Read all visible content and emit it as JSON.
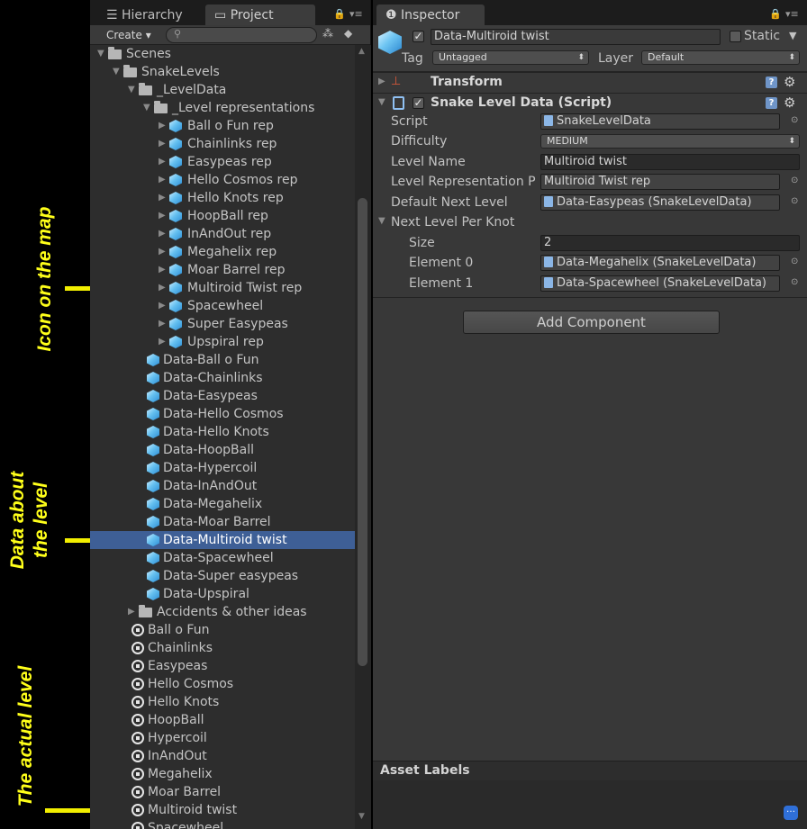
{
  "annotations": [
    {
      "text": "Icon on the map"
    },
    {
      "text": "Data about\nthe level"
    },
    {
      "text": "The actual level"
    }
  ],
  "project": {
    "tabs": [
      {
        "label": "Hierarchy"
      },
      {
        "label": "Project"
      }
    ],
    "create_label": "Create",
    "search_placeholder": "",
    "tree": [
      {
        "kind": "folder",
        "depth": 0,
        "open": true,
        "label": "Scenes"
      },
      {
        "kind": "folder",
        "depth": 1,
        "open": true,
        "label": "SnakeLevels"
      },
      {
        "kind": "folder",
        "depth": 2,
        "open": true,
        "label": "_LevelData"
      },
      {
        "kind": "folder",
        "depth": 3,
        "open": true,
        "label": "_Level representations"
      },
      {
        "kind": "prefab",
        "depth": 4,
        "label": "Ball o Fun rep"
      },
      {
        "kind": "prefab",
        "depth": 4,
        "label": "Chainlinks rep"
      },
      {
        "kind": "prefab",
        "depth": 4,
        "label": "Easypeas rep"
      },
      {
        "kind": "prefab",
        "depth": 4,
        "label": "Hello Cosmos rep"
      },
      {
        "kind": "prefab",
        "depth": 4,
        "label": "Hello Knots rep"
      },
      {
        "kind": "prefab",
        "depth": 4,
        "label": "HoopBall rep"
      },
      {
        "kind": "prefab",
        "depth": 4,
        "label": "InAndOut rep"
      },
      {
        "kind": "prefab",
        "depth": 4,
        "label": "Megahelix rep"
      },
      {
        "kind": "prefab",
        "depth": 4,
        "label": "Moar Barrel rep"
      },
      {
        "kind": "prefab",
        "depth": 4,
        "label": "Multiroid Twist rep"
      },
      {
        "kind": "prefab",
        "depth": 4,
        "label": "Spacewheel"
      },
      {
        "kind": "prefab",
        "depth": 4,
        "label": "Super Easypeas"
      },
      {
        "kind": "prefab",
        "depth": 4,
        "label": "Upspiral rep"
      },
      {
        "kind": "asset",
        "depth": 3,
        "label": "Data-Ball o Fun"
      },
      {
        "kind": "asset",
        "depth": 3,
        "label": "Data-Chainlinks"
      },
      {
        "kind": "asset",
        "depth": 3,
        "label": "Data-Easypeas"
      },
      {
        "kind": "asset",
        "depth": 3,
        "label": "Data-Hello Cosmos"
      },
      {
        "kind": "asset",
        "depth": 3,
        "label": "Data-Hello Knots"
      },
      {
        "kind": "asset",
        "depth": 3,
        "label": "Data-HoopBall"
      },
      {
        "kind": "asset",
        "depth": 3,
        "label": "Data-Hypercoil"
      },
      {
        "kind": "asset",
        "depth": 3,
        "label": "Data-InAndOut"
      },
      {
        "kind": "asset",
        "depth": 3,
        "label": "Data-Megahelix"
      },
      {
        "kind": "asset",
        "depth": 3,
        "label": "Data-Moar Barrel"
      },
      {
        "kind": "asset",
        "depth": 3,
        "label": "Data-Multiroid twist",
        "selected": true
      },
      {
        "kind": "asset",
        "depth": 3,
        "label": "Data-Spacewheel"
      },
      {
        "kind": "asset",
        "depth": 3,
        "label": "Data-Super easypeas"
      },
      {
        "kind": "asset",
        "depth": 3,
        "label": "Data-Upspiral"
      },
      {
        "kind": "folder",
        "depth": 2,
        "open": false,
        "label": "Accidents & other ideas"
      },
      {
        "kind": "scene",
        "depth": 2,
        "label": "Ball o Fun"
      },
      {
        "kind": "scene",
        "depth": 2,
        "label": "Chainlinks"
      },
      {
        "kind": "scene",
        "depth": 2,
        "label": "Easypeas"
      },
      {
        "kind": "scene",
        "depth": 2,
        "label": "Hello Cosmos"
      },
      {
        "kind": "scene",
        "depth": 2,
        "label": "Hello Knots"
      },
      {
        "kind": "scene",
        "depth": 2,
        "label": "HoopBall"
      },
      {
        "kind": "scene",
        "depth": 2,
        "label": "Hypercoil"
      },
      {
        "kind": "scene",
        "depth": 2,
        "label": "InAndOut"
      },
      {
        "kind": "scene",
        "depth": 2,
        "label": "Megahelix"
      },
      {
        "kind": "scene",
        "depth": 2,
        "label": "Moar Barrel"
      },
      {
        "kind": "scene",
        "depth": 2,
        "label": "Multiroid twist"
      },
      {
        "kind": "scene",
        "depth": 2,
        "label": "Spacewheel"
      }
    ]
  },
  "inspector": {
    "tab_label": "Inspector",
    "object_name": "Data-Multiroid twist",
    "static_label": "Static",
    "tag_label": "Tag",
    "tag_value": "Untagged",
    "layer_label": "Layer",
    "layer_value": "Default",
    "transform_title": "Transform",
    "script_component_title": "Snake Level Data (Script)",
    "fields": {
      "script_label": "Script",
      "script_value": "SnakeLevelData",
      "difficulty_label": "Difficulty",
      "difficulty_value": "MEDIUM",
      "level_name_label": "Level Name",
      "level_name_value": "Multiroid twist",
      "level_rep_label": "Level Representation P",
      "level_rep_value": "Multiroid Twist rep",
      "default_next_label": "Default Next Level",
      "default_next_value": "Data-Easypeas (SnakeLevelData)",
      "next_per_knot_label": "Next Level Per Knot",
      "size_label": "Size",
      "size_value": "2",
      "element0_label": "Element 0",
      "element0_value": "Data-Megahelix (SnakeLevelData)",
      "element1_label": "Element 1",
      "element1_value": "Data-Spacewheel (SnakeLevelData)"
    },
    "add_component_label": "Add Component",
    "asset_labels_title": "Asset Labels"
  }
}
